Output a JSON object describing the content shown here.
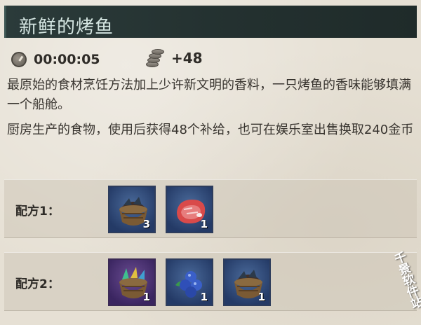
{
  "item": {
    "title": "新鲜的烤鱼",
    "time": "00:00:05",
    "supply": "+48",
    "description": [
      "最原始的食材烹饪方法加上少许新文明的香料，一只烤鱼的香味能够填满一个船舱。",
      "厨房生产的食物，使用后获得48个补给，也可在娱乐室出售换取240金币"
    ]
  },
  "icons": {
    "time": "clock-icon",
    "supply": "coin-stack-icon"
  },
  "recipes": [
    {
      "label": "配方1：",
      "ingredients": [
        {
          "icon": "fish-basket-icon",
          "count": "3",
          "frame": "blue"
        },
        {
          "icon": "raw-meat-icon",
          "count": "1",
          "frame": "blue"
        }
      ]
    },
    {
      "label": "配方2：",
      "ingredients": [
        {
          "icon": "exotic-fish-basket-icon",
          "count": "1",
          "frame": "purple"
        },
        {
          "icon": "blueberries-icon",
          "count": "1",
          "frame": "blue"
        },
        {
          "icon": "fish-basket-icon",
          "count": "1",
          "frame": "blue"
        }
      ]
    }
  ],
  "watermark": "千景软件站",
  "colors": {
    "title_bar": "#23302f",
    "title_text": "#d5e6e2",
    "item_blue": "#2e3d5c",
    "item_purple": "#3b2a55"
  }
}
